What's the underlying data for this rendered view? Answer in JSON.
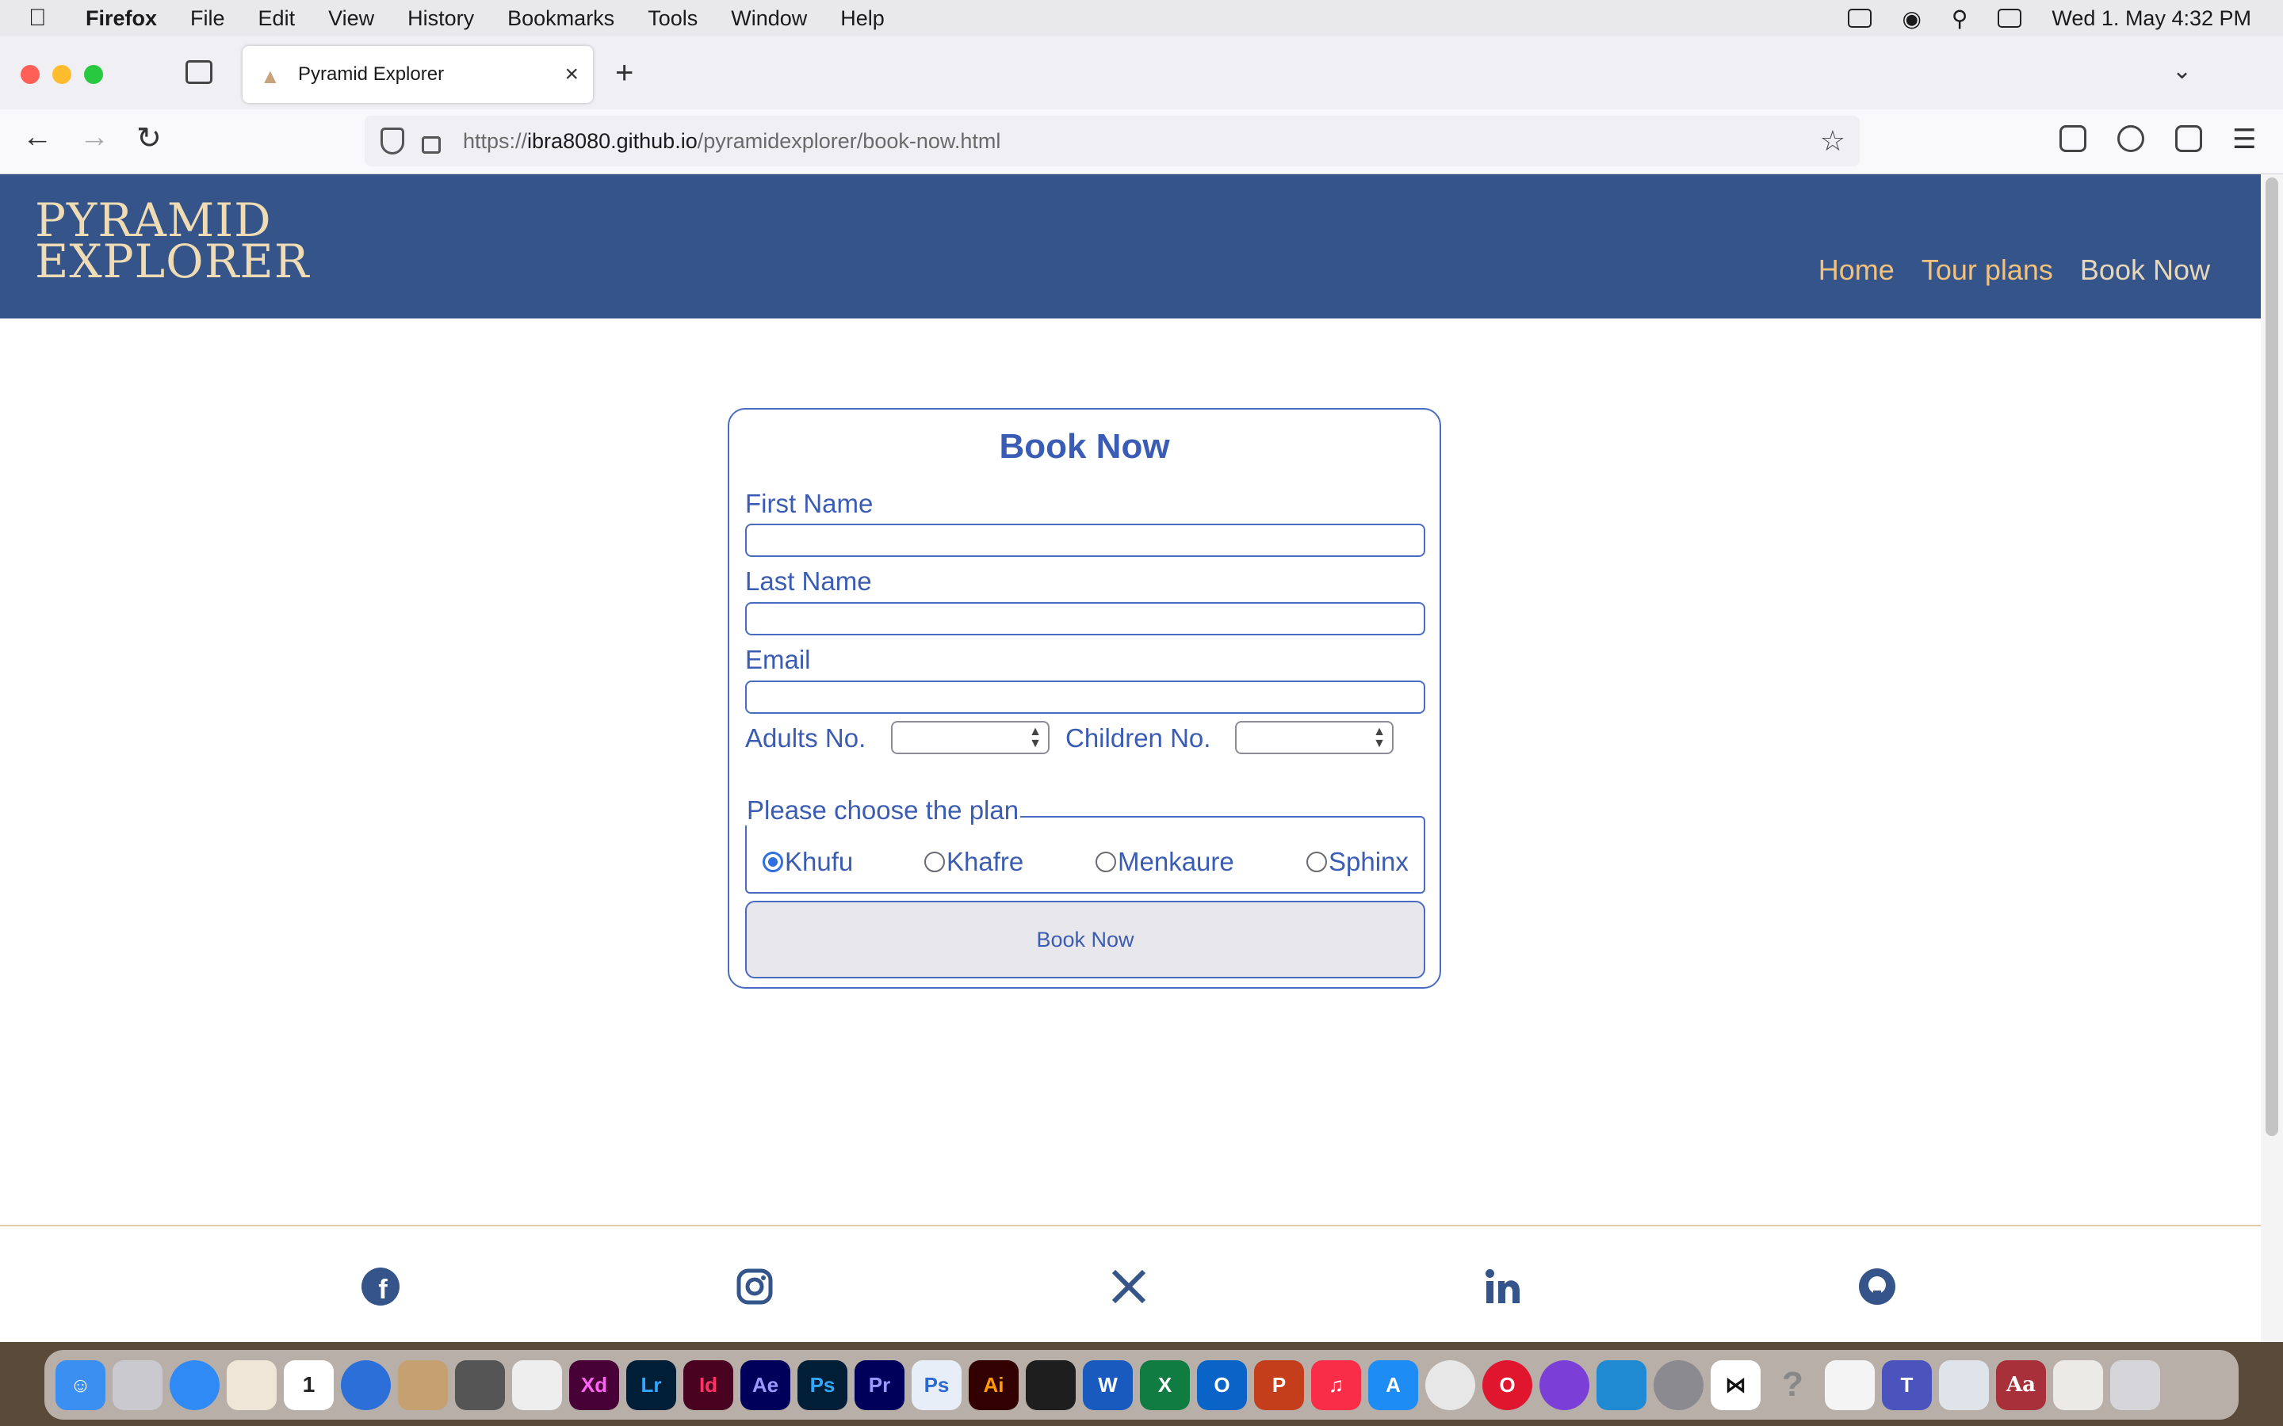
{
  "menubar": {
    "app_name": "Firefox",
    "items": [
      "File",
      "Edit",
      "View",
      "History",
      "Bookmarks",
      "Tools",
      "Window",
      "Help"
    ],
    "clock": "Wed 1. May  4:32 PM"
  },
  "browser": {
    "tab_title": "Pyramid Explorer",
    "url_scheme": "https://",
    "url_host": "ibra8080.github.io",
    "url_path": "/pyramidexplorer/book-now.html"
  },
  "site": {
    "logo_line1": "PYRAMID",
    "logo_line2": "EXPLORER",
    "nav": [
      "Home",
      "Tour plans",
      "Book Now"
    ]
  },
  "form": {
    "title": "Book Now",
    "first_name_label": "First Name",
    "last_name_label": "Last Name",
    "email_label": "Email",
    "adults_label": "Adults No.",
    "children_label": "Children No.",
    "plan_legend": "Please choose the plan",
    "plans": [
      "Khufu",
      "Khafre",
      "Menkaure",
      "Sphinx"
    ],
    "selected_plan": "Khufu",
    "submit_label": "Book Now"
  },
  "footer": {
    "social": [
      "facebook-icon",
      "instagram-icon",
      "x-icon",
      "linkedin-icon",
      "github-icon"
    ]
  },
  "colors": {
    "header_bg": "#34548a",
    "nav_link": "#f1c27d",
    "form_accent": "#3b5cb3"
  }
}
